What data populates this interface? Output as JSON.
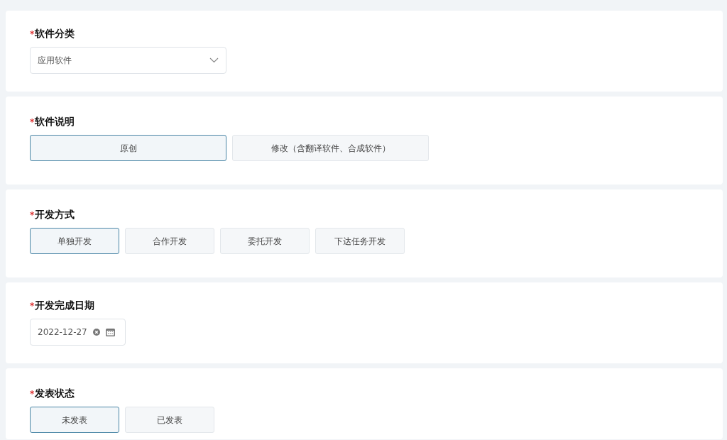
{
  "sections": [
    {
      "kind": "select",
      "required_mark": "*",
      "label": "软件分类",
      "value": "应用软件"
    },
    {
      "kind": "wide_options",
      "required_mark": "*",
      "label": "软件说明",
      "options": [
        {
          "label": "原创",
          "selected": true
        },
        {
          "label": "修改（含翻译软件、合成软件）",
          "selected": false
        }
      ]
    },
    {
      "kind": "options",
      "required_mark": "*",
      "label": "开发方式",
      "options": [
        {
          "label": "单独开发",
          "selected": true
        },
        {
          "label": "合作开发",
          "selected": false
        },
        {
          "label": "委托开发",
          "selected": false
        },
        {
          "label": "下达任务开发",
          "selected": false
        }
      ]
    },
    {
      "kind": "date",
      "required_mark": "*",
      "label": "开发完成日期",
      "value": "2022-12-27"
    },
    {
      "kind": "options",
      "required_mark": "*",
      "label": "发表状态",
      "options": [
        {
          "label": "未发表",
          "selected": true
        },
        {
          "label": "已发表",
          "selected": false
        }
      ]
    }
  ]
}
